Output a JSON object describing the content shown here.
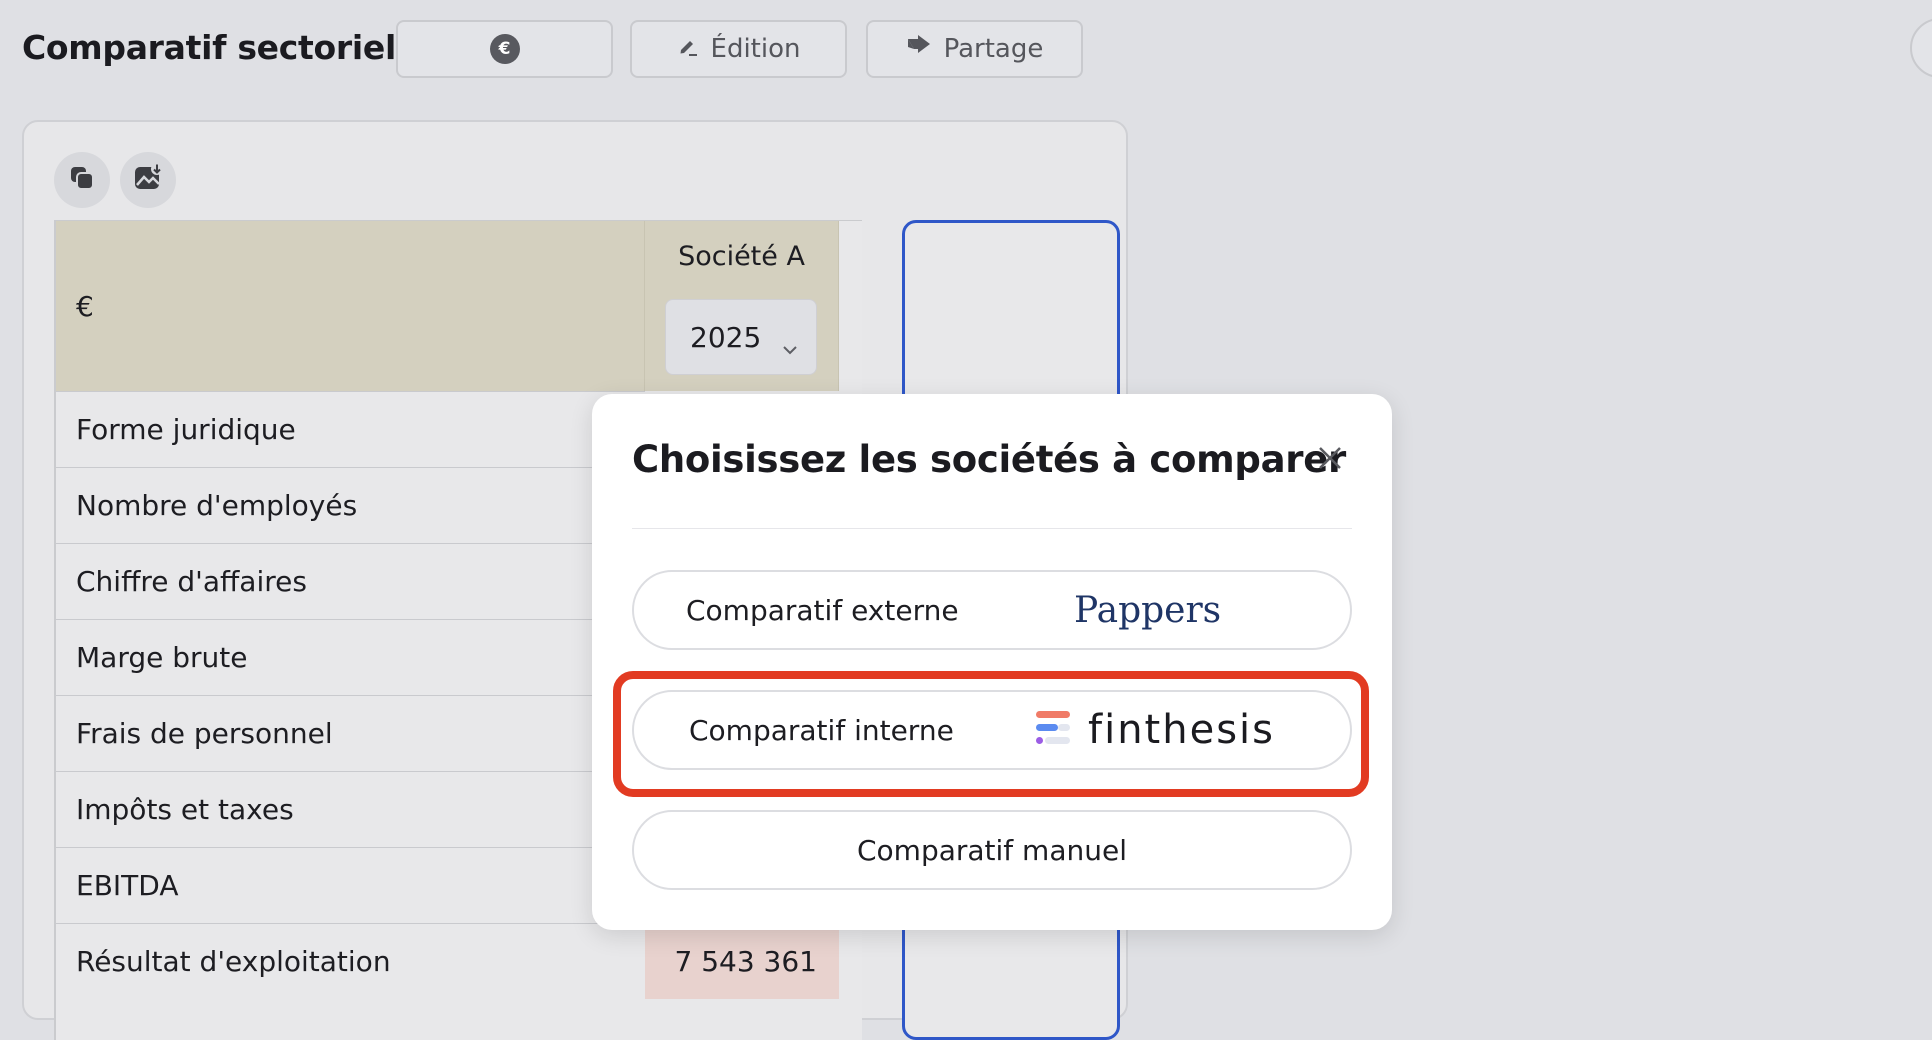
{
  "header": {
    "title": "Comparatif sectoriel",
    "currency_badge": "€",
    "edit_label": "Édition",
    "share_label": "Partage"
  },
  "table": {
    "unit_label": "€",
    "column_name": "Société A",
    "year_selected": "2025",
    "rows": [
      "Forme juridique",
      "Nombre d'employés",
      "Chiffre d'affaires",
      "Marge brute",
      "Frais de personnel",
      "Impôts et taxes",
      "EBITDA",
      "Résultat d'exploitation"
    ],
    "visible_value": "7 543 361"
  },
  "modal": {
    "title": "Choisissez les sociétés à comparer",
    "options": [
      {
        "label": "Comparatif externe",
        "brand": "Pappers"
      },
      {
        "label": "Comparatif interne",
        "brand": "finthesis"
      },
      {
        "label": "Comparatif manuel"
      }
    ]
  },
  "colors": {
    "highlight": "#e23b22",
    "add_column_border": "#2f57c8",
    "pappers_brand": "#1f3566",
    "header_band": "#d4d0bf"
  },
  "icons": [
    "euro-icon",
    "pencil-icon",
    "share-arrow-icon",
    "copy-icon",
    "image-download-icon",
    "chevron-down-icon",
    "close-icon",
    "finthesis-logo-icon"
  ]
}
